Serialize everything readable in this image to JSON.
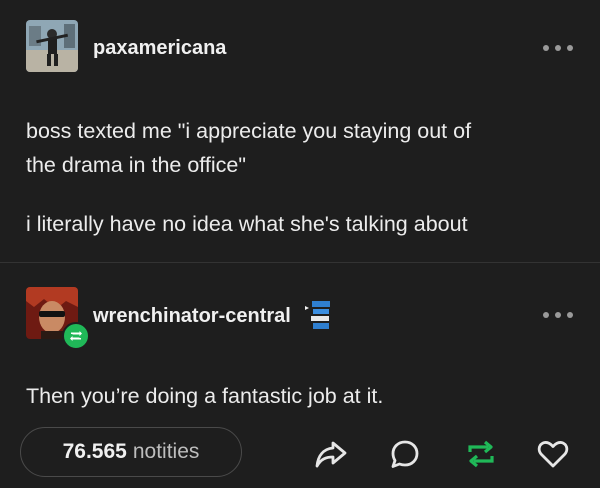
{
  "post1": {
    "username": "paxamericana",
    "lines": [
      "boss texted me \"i appreciate you staying out of",
      "the drama in the office\""
    ],
    "paragraph2": "i literally have no idea what she's talking about"
  },
  "post2": {
    "username": "wrenchinator-central",
    "body": "Then you’re doing a fantastic job at it."
  },
  "footer": {
    "notes_count": "76.565",
    "notes_label": "notities"
  },
  "colors": {
    "background": "#1e1e1e",
    "reblog_green": "#20b858"
  },
  "icons": [
    "more-icon",
    "share-icon",
    "reply-icon",
    "reblog-icon",
    "heart-icon"
  ]
}
